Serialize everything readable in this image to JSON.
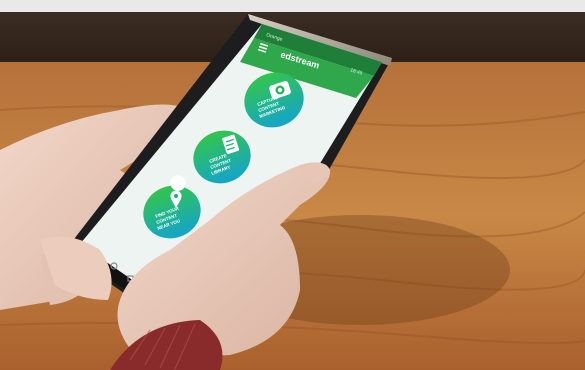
{
  "phone": {
    "app_title": "edstream",
    "status_left": "Orange",
    "status_right": "18:45",
    "buttons": [
      {
        "icon": "camera-icon",
        "label_lines": [
          "CAPTURE",
          "CONTENT",
          "MARKETING"
        ]
      },
      {
        "icon": "document-icon",
        "label_lines": [
          "CREATE",
          "CONTENT",
          "LIBRARY"
        ]
      },
      {
        "icon": "location-icon",
        "label_lines": [
          "FIND YOUR",
          "CONTENT",
          "NEAR YOU"
        ]
      }
    ]
  },
  "colors": {
    "header": "#2ea84a",
    "circle_top": "#2fbf4a",
    "circle_bottom": "#17a8c9",
    "screen_bg": "#eef4f1"
  }
}
